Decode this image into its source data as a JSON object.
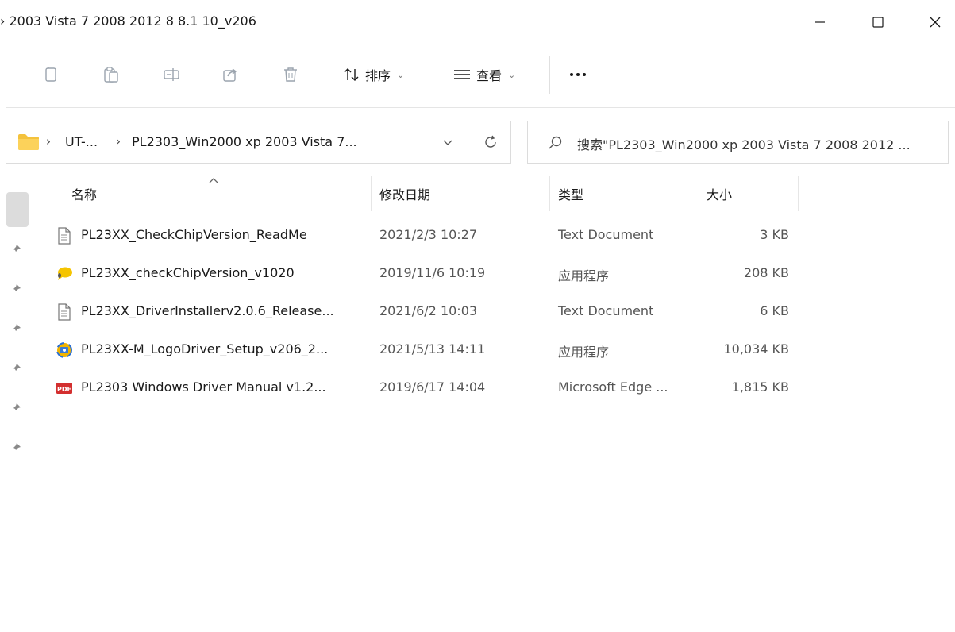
{
  "window": {
    "title": "› 2003 Vista 7 2008 2012 8 8.1 10_v206"
  },
  "toolbar": {
    "sort_label": "排序",
    "view_label": "查看"
  },
  "address": {
    "crumbs": [
      "UT-...",
      "PL2303_Win2000 xp 2003 Vista 7..."
    ]
  },
  "search": {
    "text": "搜索\"PL2303_Win2000 xp 2003 Vista 7 2008 2012 ..."
  },
  "columns": {
    "name": "名称",
    "date": "修改日期",
    "type": "类型",
    "size": "大小"
  },
  "files": [
    {
      "name": "PL23XX_CheckChipVersion_ReadMe",
      "date": "2021/2/3 10:27",
      "type": "Text Document",
      "size": "3 KB",
      "icon": "text-file-icon"
    },
    {
      "name": "PL23XX_checkChipVersion_v1020",
      "date": "2019/11/6 10:19",
      "type": "应用程序",
      "size": "208 KB",
      "icon": "app-chat-icon"
    },
    {
      "name": "PL23XX_DriverInstallerv2.0.6_Release...",
      "date": "2021/6/2 10:03",
      "type": "Text Document",
      "size": "6 KB",
      "icon": "text-file-icon"
    },
    {
      "name": "PL23XX-M_LogoDriver_Setup_v206_2...",
      "date": "2021/5/13 14:11",
      "type": "应用程序",
      "size": "10,034 KB",
      "icon": "setup-icon"
    },
    {
      "name": "PL2303 Windows Driver Manual v1.2...",
      "date": "2019/6/17 14:04",
      "type": "Microsoft Edge ...",
      "size": "1,815 KB",
      "icon": "pdf-icon"
    }
  ],
  "pdf_badge": "PDF"
}
